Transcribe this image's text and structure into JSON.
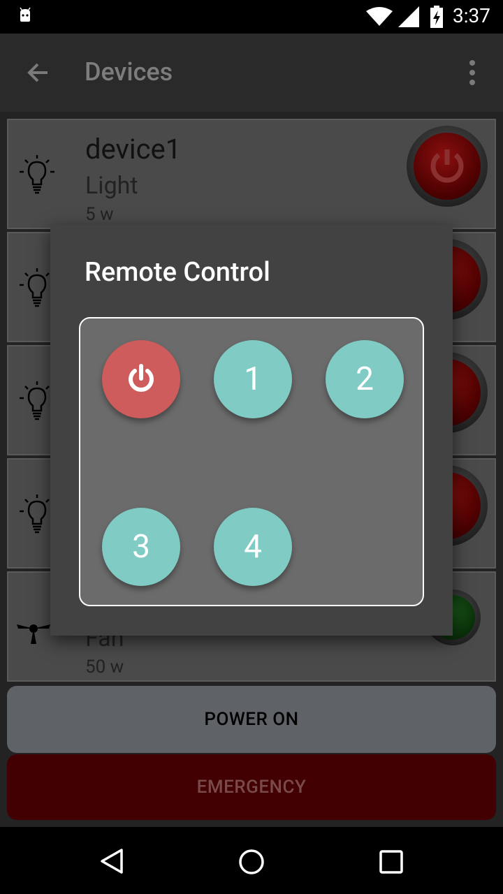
{
  "status_bar": {
    "time": "3:37",
    "icons": [
      "android-icon",
      "wifi-icon",
      "signal-icon",
      "battery-charging-icon"
    ]
  },
  "action_bar": {
    "title": "Devices",
    "back_icon": "arrow-left-icon",
    "menu_icon": "overflow-menu-icon"
  },
  "devices": [
    {
      "name": "device1",
      "type": "Light",
      "power": "5 w",
      "icon": "lightbulb-icon",
      "state": "off"
    },
    {
      "name": "",
      "type": "",
      "power": "",
      "icon": "lightbulb-icon",
      "state": "off"
    },
    {
      "name": "",
      "type": "",
      "power": "",
      "icon": "lightbulb-icon",
      "state": "off"
    },
    {
      "name": "",
      "type": "",
      "power": "",
      "icon": "lightbulb-icon",
      "state": "off"
    },
    {
      "name": "",
      "type": "Fan",
      "power": "50 w",
      "icon": "fan-icon",
      "state": "on"
    }
  ],
  "buttons": {
    "power_on": "POWER ON",
    "emergency": "EMERGENCY"
  },
  "dialog": {
    "title": "Remote Control",
    "buttons": [
      {
        "label": "",
        "icon": "power-icon",
        "color": "#cf5c5c"
      },
      {
        "label": "1",
        "color": "#80cbc4"
      },
      {
        "label": "2",
        "color": "#80cbc4"
      },
      {
        "label": "3",
        "color": "#80cbc4"
      },
      {
        "label": "4",
        "color": "#80cbc4"
      }
    ]
  },
  "nav_bar": {
    "icons": [
      "nav-back-icon",
      "nav-home-icon",
      "nav-recents-icon"
    ]
  }
}
